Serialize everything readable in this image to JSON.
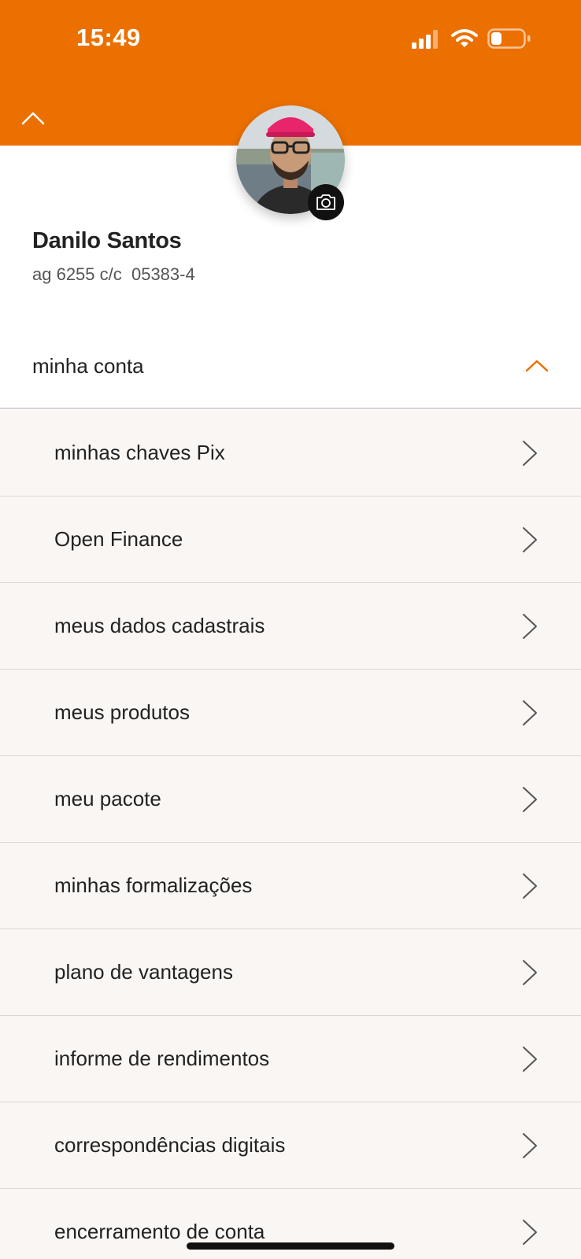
{
  "status_bar": {
    "time": "15:49",
    "icons": [
      "signal-icon",
      "wifi-icon",
      "battery-icon"
    ]
  },
  "colors": {
    "brand_orange": "#EC7000",
    "menu_background": "#F9F6F4",
    "text_dark": "#222222",
    "text_muted": "#555555"
  },
  "header": {
    "collapse_icon": "chevron-up-icon"
  },
  "profile": {
    "avatar": "profile-photo",
    "camera_icon": "camera-icon",
    "name": "Danilo Santos",
    "account": "ag 6255 c/c  05383-4"
  },
  "section": {
    "title": "minha conta",
    "toggle_icon": "chevron-up-icon"
  },
  "menu": {
    "items": [
      {
        "label": "minhas chaves Pix"
      },
      {
        "label": "Open Finance"
      },
      {
        "label": "meus dados cadastrais"
      },
      {
        "label": "meus produtos"
      },
      {
        "label": "meu pacote"
      },
      {
        "label": "minhas formalizações"
      },
      {
        "label": "plano de vantagens"
      },
      {
        "label": "informe de rendimentos"
      },
      {
        "label": "correspondências digitais"
      },
      {
        "label": "encerramento de conta"
      }
    ]
  }
}
